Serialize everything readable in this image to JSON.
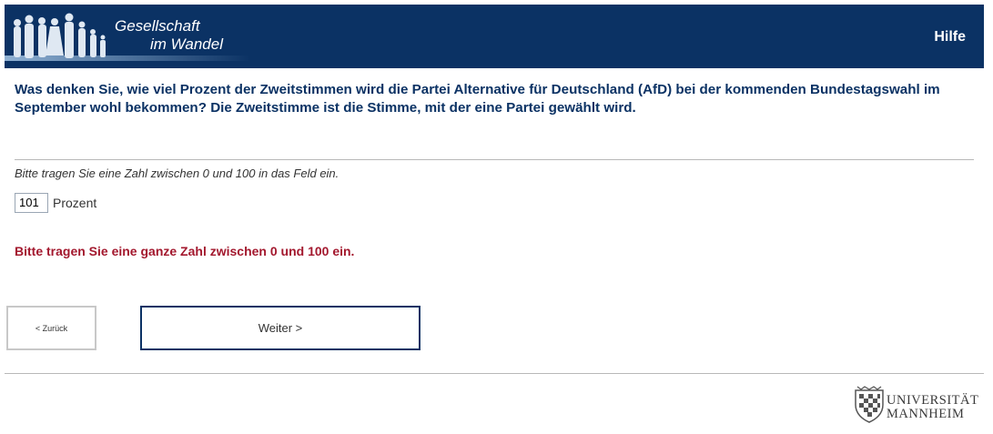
{
  "header": {
    "logo_line1": "Gesellschaft",
    "logo_line2": "im Wandel",
    "help_label": "Hilfe",
    "bg_color": "#0b3264",
    "logo_icon": "people-silhouettes-icon"
  },
  "question": {
    "text": "Was denken Sie, wie viel Prozent der Zweitstimmen wird die Partei Alternative für Deutschland (AfD) bei der kommenden Bundestagswahl im September wohl bekommen? Die Zweitstimme ist die Stimme, mit der eine Partei gewählt wird."
  },
  "answer": {
    "instruction": "Bitte tragen Sie eine Zahl zwischen 0 und 100 in das Feld ein.",
    "value": "101",
    "unit": "Prozent"
  },
  "error": {
    "text": "Bitte tragen Sie eine ganze Zahl zwischen 0 und 100 ein.",
    "color": "#a3182e"
  },
  "nav": {
    "back_label": "< Zurück",
    "next_label": "Weiter >"
  },
  "footer": {
    "university_line1": "UNIVERSITÄT",
    "university_line2": "MANNHEIM",
    "crest_icon": "university-crest-icon"
  }
}
